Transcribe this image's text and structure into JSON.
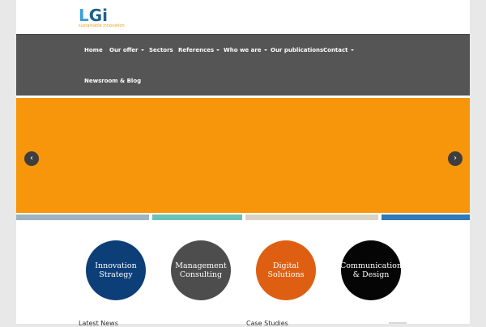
{
  "logo": {
    "main_a": "L",
    "main_b": "Gi",
    "tagline": "sustainable innovation"
  },
  "nav": {
    "items": [
      {
        "label": "Home",
        "dropdown": false
      },
      {
        "label": "Our offer",
        "dropdown": true
      },
      {
        "label": "Sectors",
        "dropdown": false
      },
      {
        "label": "References",
        "dropdown": true
      },
      {
        "label": "Who we are",
        "dropdown": true
      },
      {
        "label": "Our publications",
        "dropdown": false
      },
      {
        "label": "Contact",
        "dropdown": true
      },
      {
        "label": "Newsroom & Blog",
        "dropdown": false
      }
    ]
  },
  "slider": {
    "prev_symbol": "‹",
    "next_symbol": "›",
    "background_color": "#f7960a",
    "thumb_colors": [
      "#9fb3c0",
      "#6cc3b4",
      "#d9d3c6",
      "#2f7ab8"
    ]
  },
  "services": [
    {
      "label_l1": "Innovation",
      "label_l2": "Strategy",
      "color": "#0c3e78"
    },
    {
      "label_l1": "Management",
      "label_l2": "Consulting",
      "color": "#4d4d4d"
    },
    {
      "label_l1": "Digital",
      "label_l2": "Solutions",
      "color": "#df5f12"
    },
    {
      "label_l1": "Communication",
      "label_l2": "& Design",
      "color": "#050505"
    }
  ],
  "bottom": {
    "latest_news": "Latest News",
    "case_studies": "Case Studies"
  }
}
